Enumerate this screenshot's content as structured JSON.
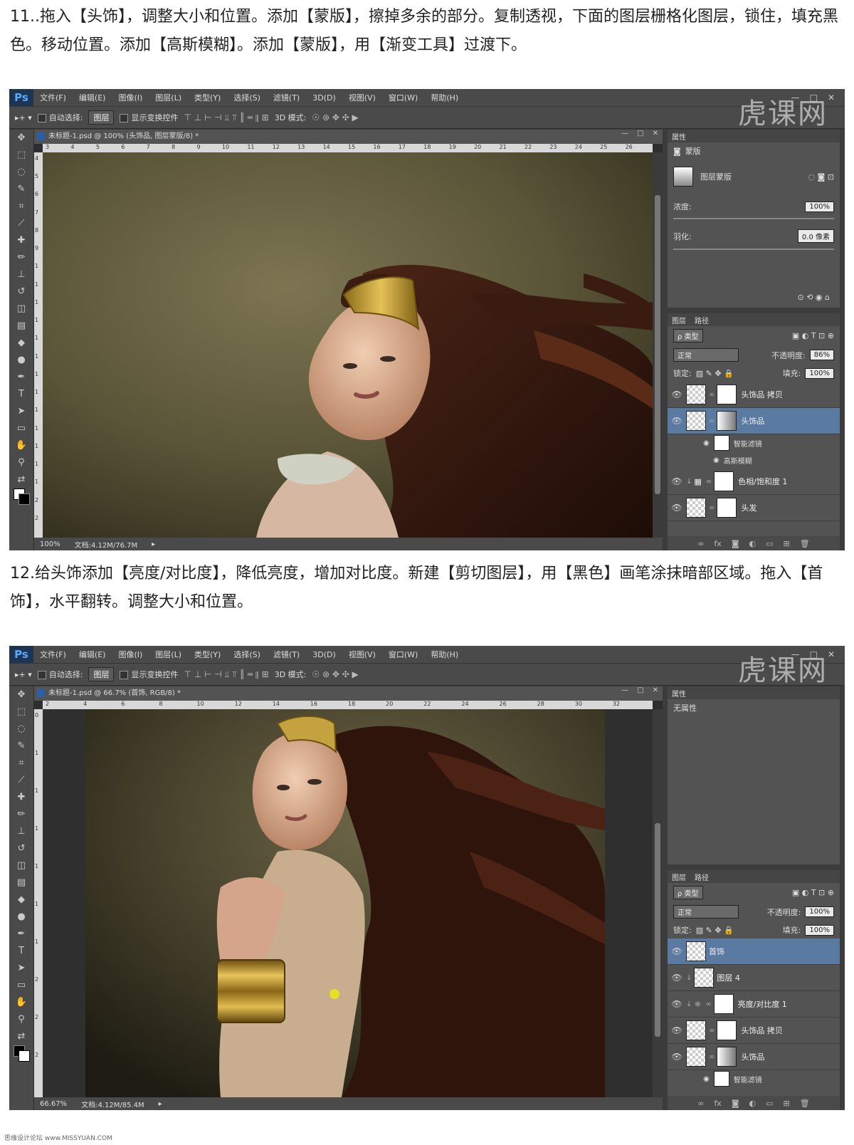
{
  "step11": {
    "text": "11..拖入【头饰】，调整大小和位置。添加【蒙版】，擦掉多余的部分。复制透视，下面的图层栅格化图层，锁住，填充黑色。移动位置。添加【高斯模糊】。添加【蒙版】，用【渐变工具】过渡下。"
  },
  "step12": {
    "text": "12.给头饰添加【亮度/对比度】，降低亮度，增加对比度。新建【剪切图层】，用【黑色】画笔涂抹暗部区域。拖入【首饰】，水平翻转。调整大小和位置。"
  },
  "app": {
    "logo": "Ps",
    "menu": [
      "文件(F)",
      "编辑(E)",
      "图像(I)",
      "图层(L)",
      "类型(Y)",
      "选择(S)",
      "滤镜(T)",
      "3D(D)",
      "视图(V)",
      "窗口(W)",
      "帮助(H)"
    ],
    "options": {
      "auto_select": "自动选择:",
      "group_value": "图层",
      "show_transform": "显示变换控件",
      "mode_3d": "3D 模式:"
    },
    "watermark": "虎课网"
  },
  "shot1": {
    "doc_tab": "未标题-1.psd @ 100% (头饰品, 图层蒙版/8) *",
    "ruler_h": [
      "3",
      "4",
      "5",
      "6",
      "7",
      "8",
      "9",
      "10",
      "11",
      "12",
      "13",
      "14",
      "15",
      "16",
      "17",
      "18",
      "19",
      "20",
      "21",
      "22",
      "23",
      "24",
      "25",
      "26"
    ],
    "ruler_v": [
      "4",
      "5",
      "6",
      "7",
      "8",
      "9",
      "1",
      "1",
      "1",
      "1",
      "1",
      "1",
      "1",
      "1",
      "1",
      "1",
      "1",
      "1",
      "1",
      "2",
      "2"
    ],
    "status": {
      "zoom": "100%",
      "doc": "文档:4.12M/76.7M"
    },
    "properties": {
      "tab": "属性",
      "mask_label": "蒙版",
      "layer_mask": "图层蒙版",
      "density_label": "浓度:",
      "density_value": "100%",
      "feather_label": "羽化:",
      "feather_value": "0.0 像素"
    },
    "layers_panel": {
      "tabs": [
        "图层",
        "路径"
      ],
      "kind": "ρ 类型",
      "blend": "正常",
      "opacity_label": "不透明度:",
      "opacity_value": "86%",
      "lock_label": "锁定:",
      "fill_label": "填充:",
      "fill_value": "100%",
      "layers": [
        "头饰品 拷贝",
        "头饰品",
        "智能滤镜",
        "高斯模糊",
        "色相/饱和度 1",
        "头发"
      ]
    }
  },
  "shot2": {
    "doc_tab": "未标题-1.psd @ 66.7% (首饰, RGB/8) *",
    "ruler_h": [
      "2",
      "4",
      "6",
      "8",
      "10",
      "12",
      "14",
      "16",
      "18",
      "20",
      "22",
      "24",
      "26",
      "28",
      "30",
      "32"
    ],
    "ruler_v": [
      "0",
      "1",
      "1",
      "1",
      "1",
      "1",
      "1",
      "2",
      "2",
      "2"
    ],
    "status": {
      "zoom": "66.67%",
      "doc": "文档:4.12M/85.4M"
    },
    "properties": {
      "tab": "属性",
      "empty": "无属性"
    },
    "layers_panel": {
      "tabs": [
        "图层",
        "路径"
      ],
      "kind": "ρ 类型",
      "blend": "正常",
      "opacity_label": "不透明度:",
      "opacity_value": "100%",
      "lock_label": "锁定:",
      "fill_label": "填充:",
      "fill_value": "100%",
      "layers": [
        "首饰",
        "图层 4",
        "亮度/对比度 1",
        "头饰品 拷贝",
        "头饰品",
        "智能滤镜"
      ]
    }
  },
  "footer": "思缘设计论坛 www.MISSYUAN.COM"
}
